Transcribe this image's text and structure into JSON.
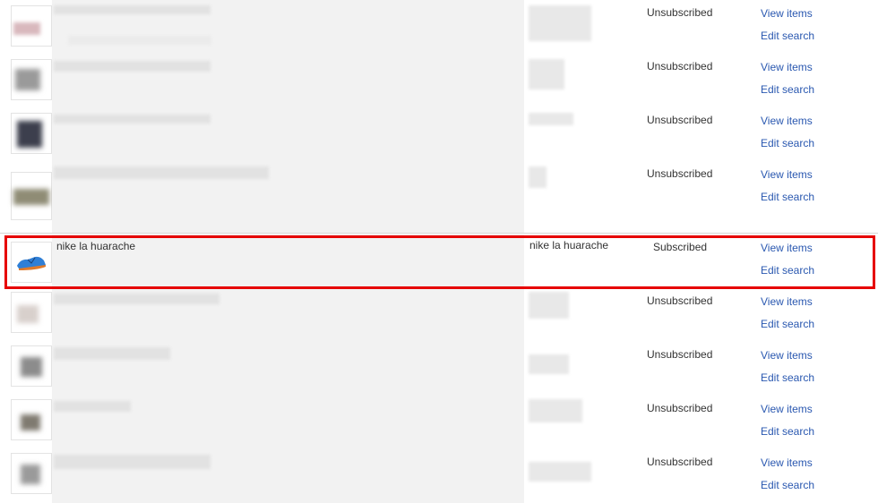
{
  "rows": [
    {
      "status": "Unsubscribed",
      "view": "View items",
      "edit": "Edit search"
    },
    {
      "status": "Unsubscribed",
      "view": "View items",
      "edit": "Edit search"
    },
    {
      "status": "Unsubscribed",
      "view": "View items",
      "edit": "Edit search"
    },
    {
      "status": "Unsubscribed",
      "view": "View items",
      "edit": "Edit search"
    },
    {
      "title": "nike la huarache",
      "keywords": "nike la huarache",
      "status": "Subscribed",
      "view": "View items",
      "edit": "Edit search",
      "thumb_icon": "blue-sneaker-icon",
      "highlight_color": "#e60000"
    },
    {
      "status": "Unsubscribed",
      "view": "View items",
      "edit": "Edit search"
    },
    {
      "status": "Unsubscribed",
      "view": "View items",
      "edit": "Edit search"
    },
    {
      "status": "Unsubscribed",
      "view": "View items",
      "edit": "Edit search"
    },
    {
      "status": "Unsubscribed",
      "view": "View items",
      "edit": "Edit search"
    }
  ],
  "colors": {
    "link": "#2a58b0",
    "highlight": "#e60000",
    "redacted": "#f2f2f2"
  }
}
